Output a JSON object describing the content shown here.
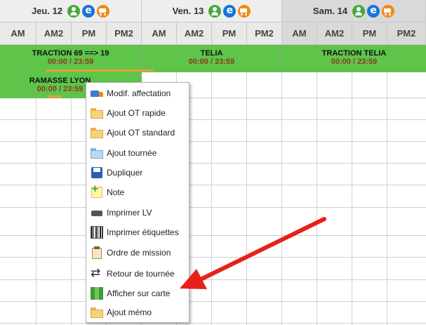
{
  "days": [
    {
      "title": "Jeu. 12",
      "icons": [
        "user-icon",
        "eco-icon",
        "truck-icon"
      ]
    },
    {
      "title": "Ven. 13",
      "icons": [
        "user-icon",
        "eco-icon",
        "truck-icon"
      ]
    },
    {
      "title": "Sam. 14",
      "icons": [
        "user-icon",
        "eco-icon",
        "truck-icon"
      ]
    }
  ],
  "slots": [
    "AM",
    "AM2",
    "PM",
    "PM2",
    "AM",
    "AM2",
    "PM",
    "PM2",
    "AM",
    "AM2",
    "PM",
    "PM2"
  ],
  "events": [
    {
      "title": "TRACTION 69 ==> 19",
      "time": "00:00 / 23:59"
    },
    {
      "title": "TELIA",
      "time": "00:00 / 23:59"
    },
    {
      "title": "TRACTION TELIA",
      "time": "00:00 / 23:59"
    },
    {
      "title": "RAMASSE LYON",
      "time": "00:00 / 23:59"
    }
  ],
  "context_menu": {
    "items": [
      {
        "label": "Modif. affectation",
        "icon": "truck-icon"
      },
      {
        "label": "Ajout OT rapide",
        "icon": "folder-icon"
      },
      {
        "label": "Ajout OT standard",
        "icon": "folder-icon"
      },
      {
        "label": "Ajout tournée",
        "icon": "folder-blue-icon"
      },
      {
        "label": "Dupliquer",
        "icon": "floppy-icon"
      },
      {
        "label": "Note",
        "icon": "note-icon"
      },
      {
        "label": "Imprimer LV",
        "icon": "printer-icon"
      },
      {
        "label": "Imprimer étiquettes",
        "icon": "barcode-icon"
      },
      {
        "label": "Ordre de mission",
        "icon": "clipboard-icon"
      },
      {
        "label": "Retour de tournée",
        "icon": "swap-arrows-icon"
      },
      {
        "label": "Afficher sur carte",
        "icon": "map-icon"
      },
      {
        "label": "Ajout mémo",
        "icon": "folder-icon"
      }
    ]
  },
  "colors": {
    "event_green": "#5ec44a",
    "time_text": "#8a3b1a",
    "arrow_red": "#e8201a"
  }
}
